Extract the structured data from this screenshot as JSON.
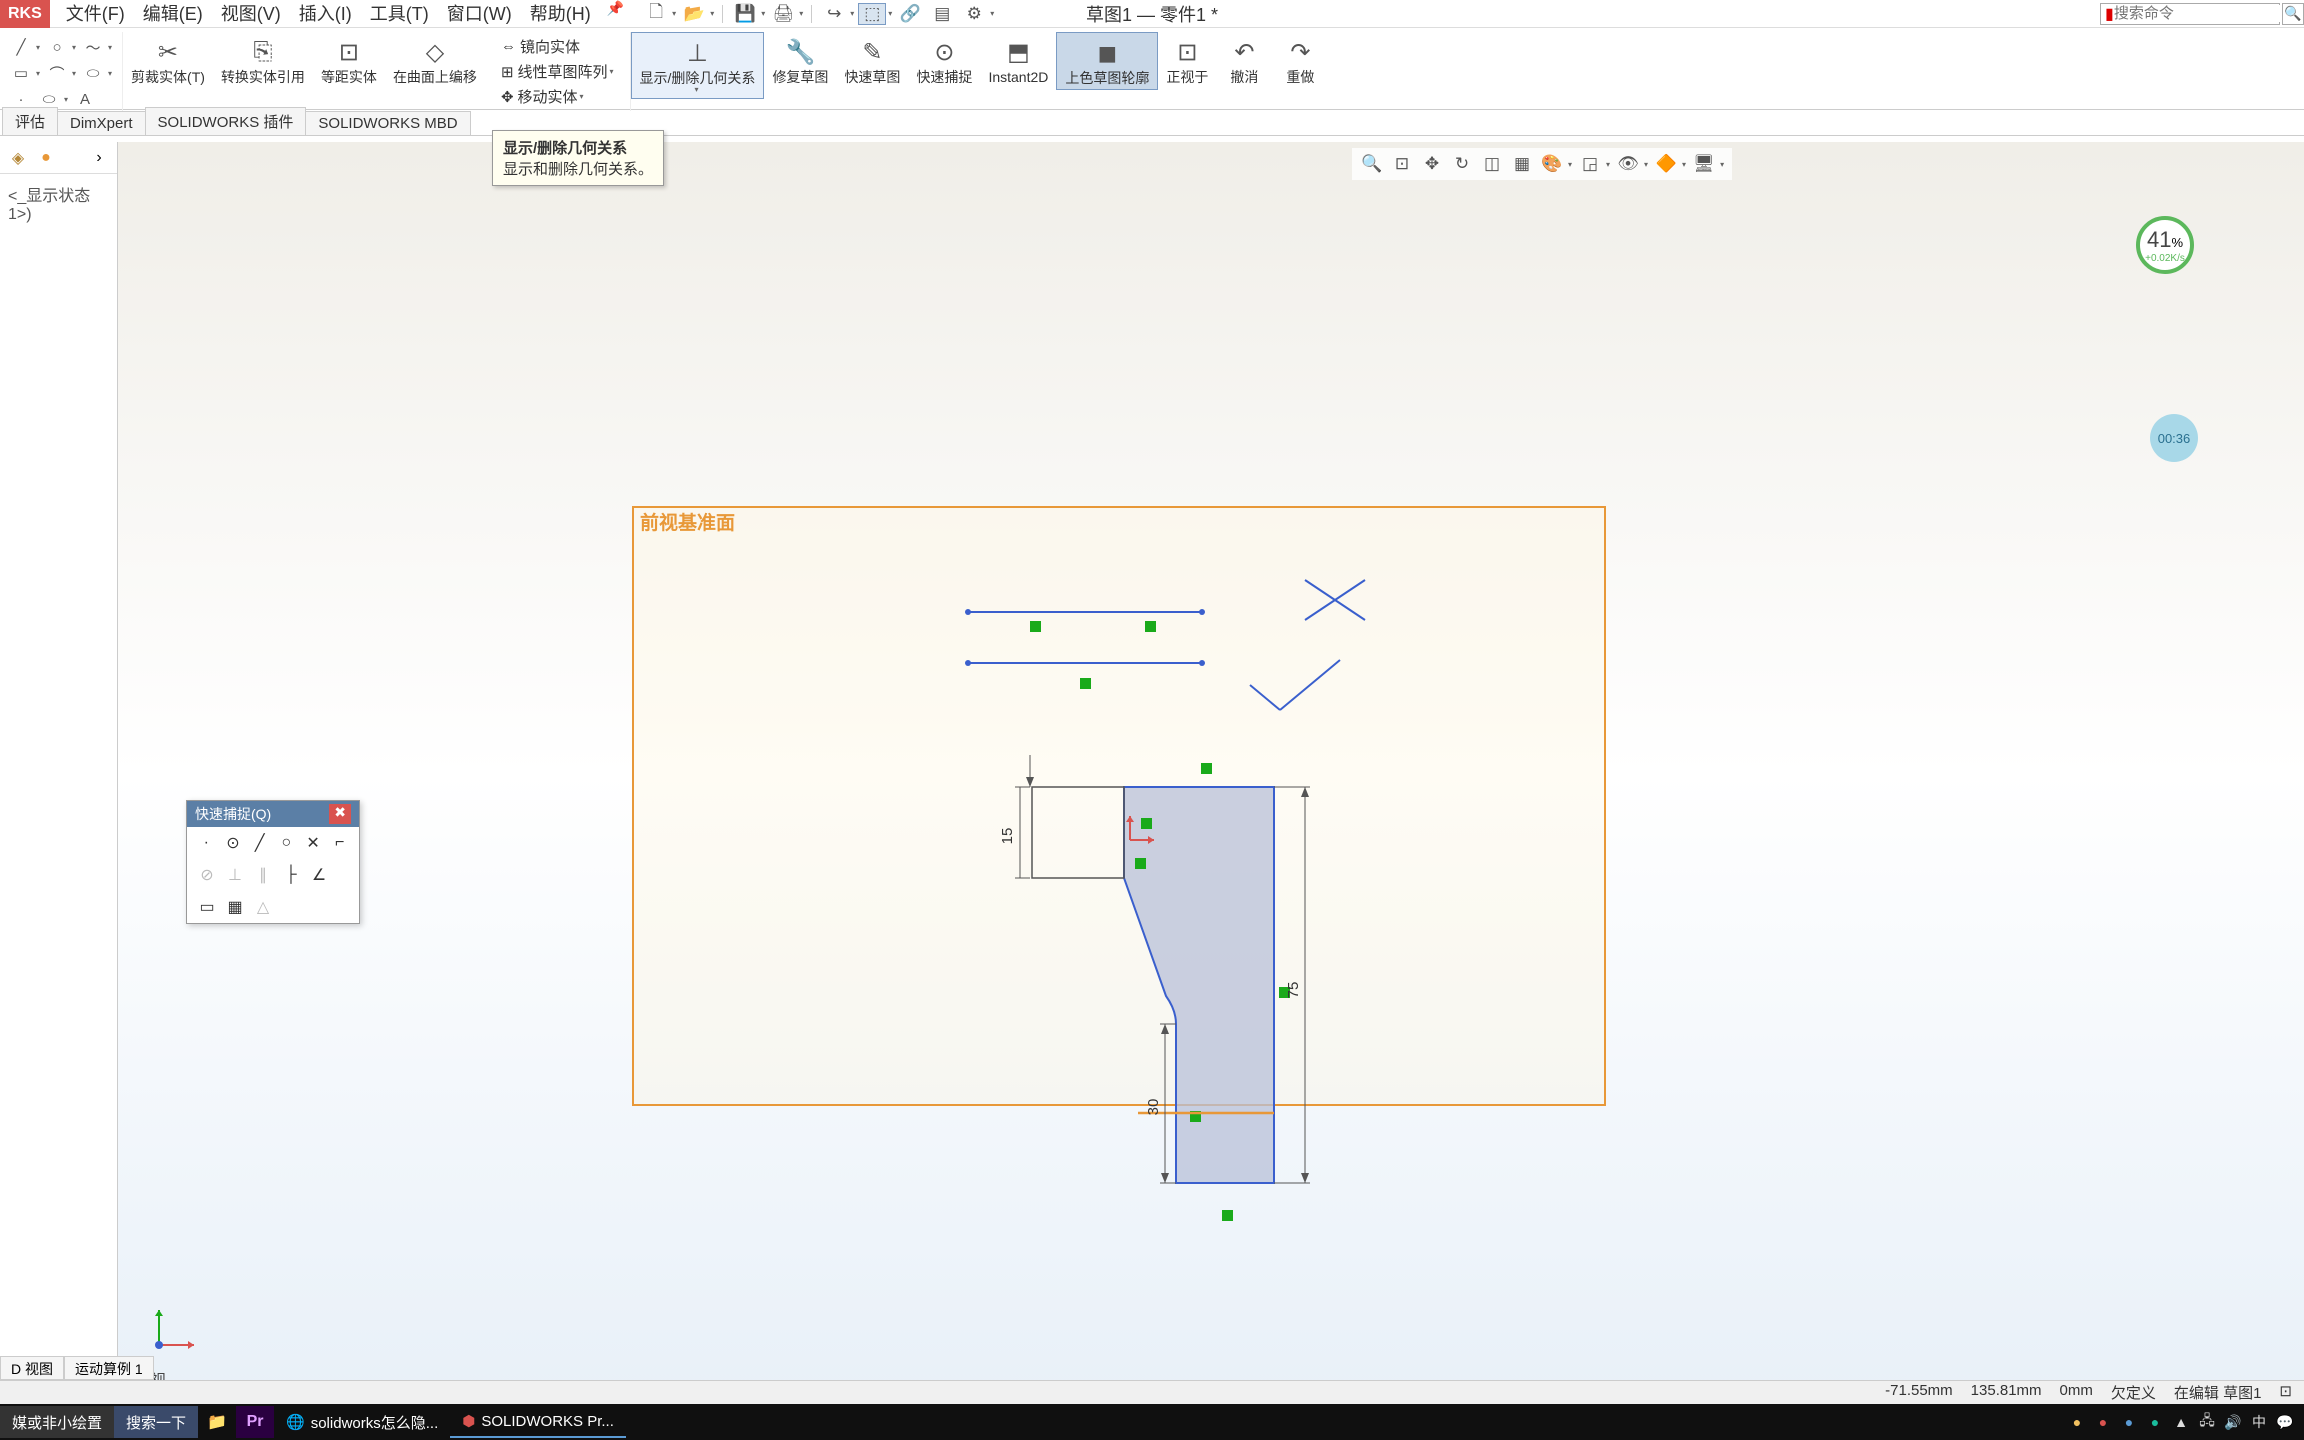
{
  "logo": "RKS",
  "menu": [
    "文件(F)",
    "编辑(E)",
    "视图(V)",
    "插入(I)",
    "工具(T)",
    "窗口(W)",
    "帮助(H)"
  ],
  "doc_title": "草图1 — 零件1 *",
  "search_placeholder": "搜索命令",
  "ribbon": {
    "sketch_tools": [
      "线条",
      "圆",
      "弧",
      "样条",
      "文字"
    ],
    "group_labels": {
      "trim": "剪裁实体(T)",
      "convert": "转换实体引用",
      "offset": "等距实体",
      "surface": "在曲面上编移",
      "mirror": "镜向实体",
      "linear_pattern": "线性草图阵列",
      "move": "移动实体",
      "display_relations": "显示/删除几何关系",
      "repair": "修复草图",
      "quick_sketch": "快速草图",
      "quick_snap": "快速捕捉",
      "instant2d": "Instant2D",
      "shade": "上色草图轮廓",
      "normal": "正视于",
      "undo": "撤消",
      "redo": "重做"
    }
  },
  "tabs": [
    "评估",
    "DimXpert",
    "SOLIDWORKS 插件",
    "SOLIDWORKS MBD"
  ],
  "feature_tree_state": "<_显示状态 1>)",
  "tooltip": {
    "title": "显示/删除几何关系",
    "desc": "显示和删除几何关系。"
  },
  "perf": {
    "percent": "41",
    "unit": "%",
    "rate": "+0.02K/s"
  },
  "time_badge": "00:36",
  "snap_panel_title": "快速捕捉(Q)",
  "plane_label": "前视基准面",
  "dimensions": {
    "d1": "15",
    "d2": "75",
    "d3": "30"
  },
  "view_name": "*前视",
  "bottom_tabs": [
    "D 视图",
    "运动算例 1"
  ],
  "status": {
    "x": "-71.55mm",
    "y": "135.81mm",
    "z": "0mm",
    "state": "欠定义",
    "mode": "在编辑 草图1"
  },
  "taskbar": {
    "items": [
      "媒或非小绘置",
      "搜索一下",
      "solidworks怎么隐...",
      "SOLIDWORKS Pr..."
    ]
  }
}
